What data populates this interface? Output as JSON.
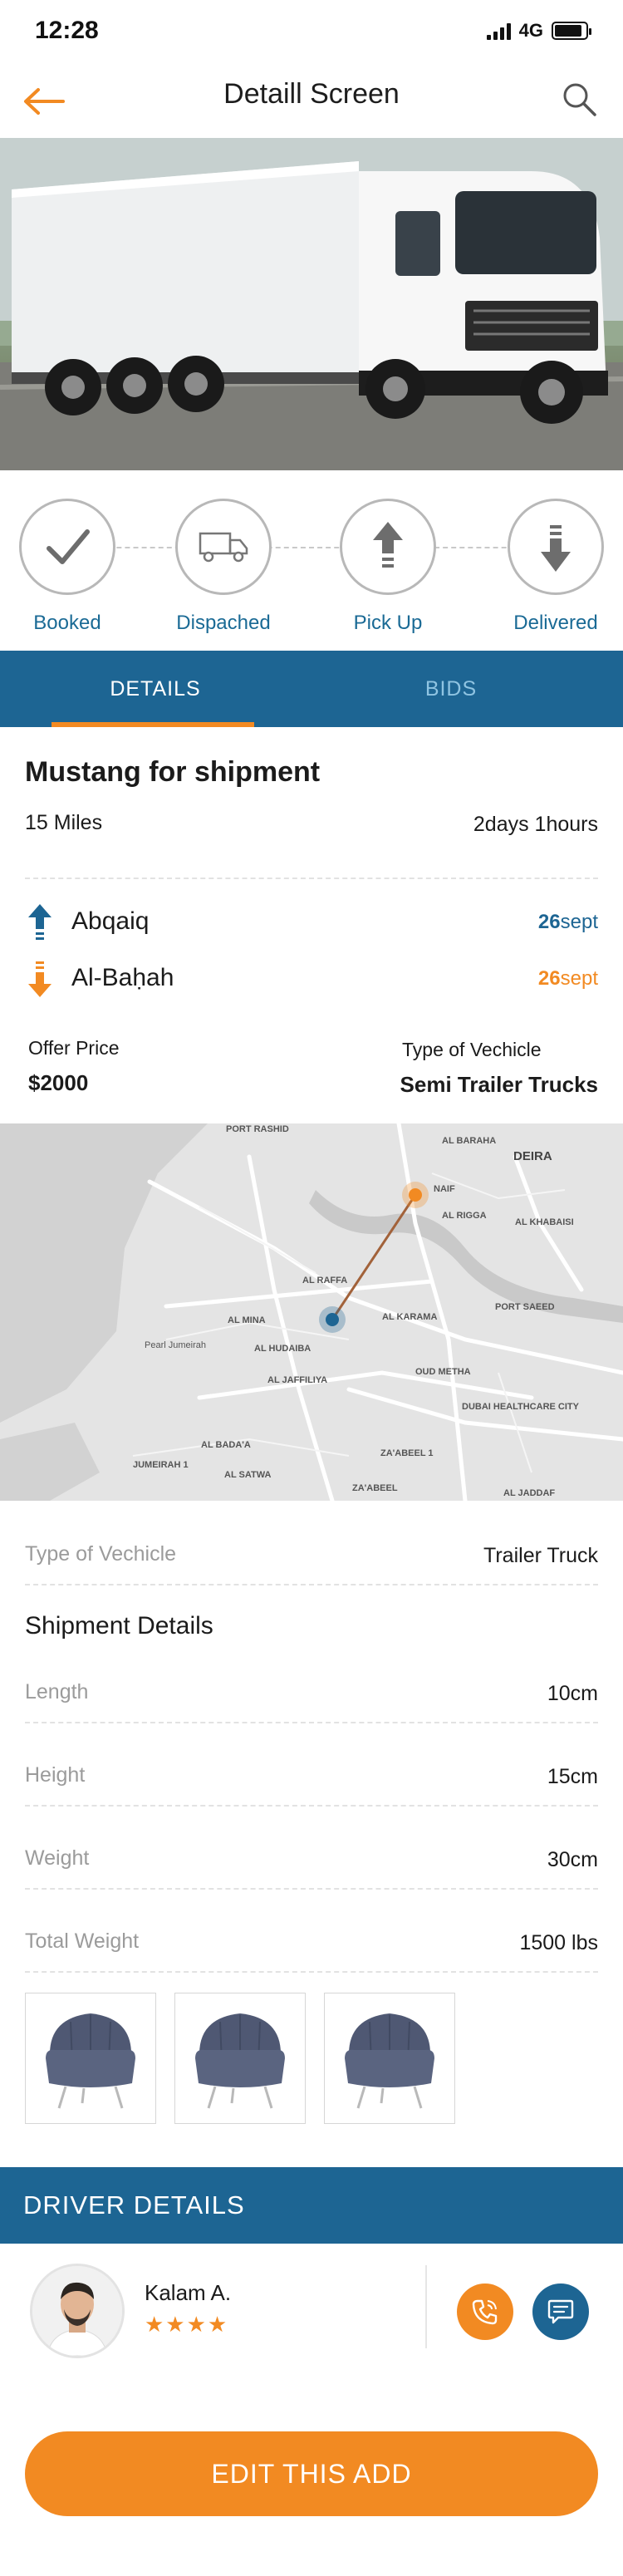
{
  "status_bar": {
    "time": "12:28",
    "network": "4G",
    "battery_level": 0.9
  },
  "header": {
    "title": "Detaill Screen",
    "back_icon": "arrow-left-icon",
    "search_icon": "search-icon"
  },
  "hero": {
    "image": "white-box-truck-photo"
  },
  "steps": [
    {
      "label": "Booked",
      "icon": "checkmark-icon"
    },
    {
      "label": "Dispached",
      "icon": "truck-icon"
    },
    {
      "label": "Pick Up",
      "icon": "arrow-up-icon"
    },
    {
      "label": "Delivered",
      "icon": "arrow-down-icon"
    }
  ],
  "tabs": {
    "details": "DETAILS",
    "bids": "BIDS",
    "active": "details"
  },
  "shipment": {
    "title": "Mustang for shipment",
    "distance": "15 Miles",
    "duration": "2days 1hours",
    "origin": {
      "city": "Abqaiq",
      "day": "26",
      "month": "sept",
      "color": "#1d6593"
    },
    "destination": {
      "city": "Al-Baḥah",
      "day": "26",
      "month": "sept",
      "color": "#f28a22"
    },
    "offer_label": "Offer Price",
    "offer_value": "$2000",
    "vehicle_type_label": "Type of Vechicle",
    "vehicle_type_value": "Semi Trailer Trucks"
  },
  "map": {
    "labels": {
      "port_rashid": "PORT RASHID",
      "al_baraha": "AL BARAHA",
      "deira": "DEIRA",
      "naif": "NAIF",
      "al_rigga": "AL RIGGA",
      "al_khabaisi": "AL KHABAISI",
      "al_raffa": "AL RAFFA",
      "al_mina": "AL MINA",
      "pearl_jumeirah": "Pearl Jumeirah",
      "al_karama": "AL KARAMA",
      "port_saeed": "PORT SAEED",
      "al_hudaiba": "AL HUDAIBA",
      "oud_metha": "OUD METHA",
      "al_jaffiliya": "AL JAFFILIYA",
      "dubai_healthcare_city": "DUBAI HEALTHCARE CITY",
      "al_badaa": "AL BADA'A",
      "zaabeel_1": "ZA'ABEEL 1",
      "jumeirah_1": "JUMEIRAH 1",
      "al_satwa": "AL SATWA",
      "zaabeel": "ZA'ABEEL",
      "al_jaddaf": "AL JADDAF"
    }
  },
  "details": {
    "vehicle_type": {
      "label": "Type of Vechicle",
      "value": "Trailer Truck"
    },
    "section_title": "Shipment Details",
    "rows": [
      {
        "label": "Length",
        "value": "10cm"
      },
      {
        "label": "Height",
        "value": "15cm"
      },
      {
        "label": "Weight",
        "value": "30cm"
      },
      {
        "label": "Total Weight",
        "value": "1500 lbs"
      }
    ],
    "thumbnails": [
      "armchair-photo",
      "armchair-photo",
      "armchair-photo"
    ]
  },
  "driver": {
    "section_title": "DRIVER DETAILS",
    "name": "Kalam A.",
    "stars": "★★★★",
    "rating": 4,
    "call_icon": "phone-icon",
    "chat_icon": "chat-icon"
  },
  "actions": {
    "edit_label": "EDIT THIS ADD"
  },
  "colors": {
    "brand_blue": "#1d6593",
    "accent_orange": "#f28a22",
    "muted_text": "#9b9b9b"
  }
}
